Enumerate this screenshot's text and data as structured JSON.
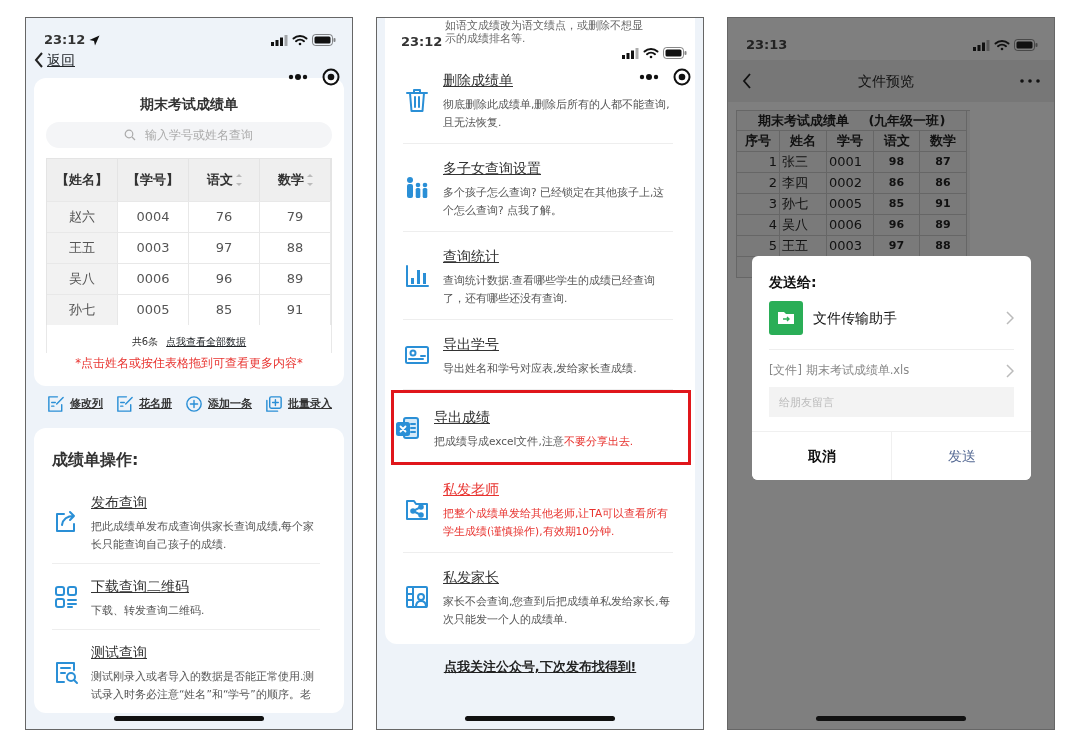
{
  "phones": [
    {
      "kind": "scores",
      "time": "23:12",
      "location": true,
      "back": "返回",
      "title": "期末考试成绩单",
      "search": {
        "placeholder": "输入学号或姓名查询"
      },
      "table": {
        "columns": [
          {
            "label": "【姓名】",
            "sortable": false
          },
          {
            "label": "【学号】",
            "sortable": false
          },
          {
            "label": "语文",
            "sortable": true
          },
          {
            "label": "数学",
            "sortable": true
          }
        ],
        "rows": [
          [
            "赵六",
            "0004",
            "76",
            "79"
          ],
          [
            "王五",
            "0003",
            "97",
            "88"
          ],
          [
            "吴八",
            "0006",
            "96",
            "89"
          ],
          [
            "孙七",
            "0005",
            "85",
            "91"
          ]
        ]
      },
      "count": "共6条",
      "view_all": "点我查看全部数据",
      "hint": "*点击姓名或按住表格拖到可查看更多内容*",
      "tools": [
        {
          "kind": "edit",
          "label": "修改列"
        },
        {
          "kind": "edit",
          "label": "花名册"
        },
        {
          "kind": "add",
          "label": "添加一条"
        },
        {
          "kind": "batch",
          "label": "批量录入"
        }
      ],
      "section_title": "成绩单操作:",
      "actions": [
        {
          "kind": "publish",
          "title": "发布查询",
          "desc": "把此成绩单发布成查询供家长查询成绩,每个家长只能查询自己孩子的成绩.",
          "warning": false,
          "highlighted": false
        },
        {
          "kind": "qrcode",
          "title": "下载查询二维码",
          "desc": "下载、转发查询二维码.",
          "warning": false,
          "highlighted": false
        },
        {
          "kind": "test",
          "title": "测试查询",
          "desc": "测试刚录入或者导入的数据是否能正常使用.测试录入时务必注意“姓名”和“学号”的顺序。老",
          "warning": false,
          "highlighted": false
        }
      ]
    },
    {
      "kind": "menu",
      "time": "23:12",
      "top_text": "如语文成绩改为语文绩点，或删除不想显示的成绩排名等.",
      "actions": [
        {
          "kind": "delete",
          "title": "删除成绩单",
          "desc": "彻底删除此成绩单,删除后所有的人都不能查询,且无法恢复.",
          "warning": false,
          "highlighted": false
        },
        {
          "kind": "children",
          "title": "多子女查询设置",
          "desc": "多个孩子怎么查询? 已经锁定在其他孩子上,这个怎么查询? 点我了解。",
          "warning": false,
          "highlighted": false
        },
        {
          "kind": "stats",
          "title": "查询统计",
          "desc": "查询统计数据.查看哪些学生的成绩已经查询了，还有哪些还没有查询.",
          "warning": false,
          "highlighted": false
        },
        {
          "kind": "export_id",
          "title": "导出学号",
          "desc": "导出姓名和学号对应表,发给家长查成绩.",
          "warning": false,
          "highlighted": false
        },
        {
          "kind": "excel",
          "title": "导出成绩",
          "desc": "把成绩导成excel文件,注意",
          "desc_warning": "不要分享出去.",
          "warning": false,
          "highlighted": true
        },
        {
          "kind": "share",
          "title": "私发老师",
          "desc": "把整个成绩单发给其他老师,让TA可以查看所有学生成绩(谨慎操作),有效期10分钟.",
          "warning": true,
          "highlighted": false
        },
        {
          "kind": "parent",
          "title": "私发家长",
          "desc": "家长不会查询,您查到后把成绩单私发给家长,每次只能发一个人的成绩单.",
          "warning": false,
          "highlighted": false
        }
      ],
      "footer": "点我关注公众号,下次发布找得到!"
    },
    {
      "kind": "preview",
      "time": "23:13",
      "title": "文件预览",
      "sheet": {
        "title": "期末考试成绩单",
        "subtitle": "(九年级一班)",
        "columns": [
          "序号",
          "姓名",
          "学号",
          "语文",
          "数学"
        ],
        "rows": [
          [
            "1",
            "张三",
            "0001",
            "98",
            "87"
          ],
          [
            "2",
            "李四",
            "0002",
            "86",
            "86"
          ],
          [
            "3",
            "孙七",
            "0005",
            "85",
            "91"
          ],
          [
            "4",
            "吴八",
            "0006",
            "96",
            "89"
          ],
          [
            "5",
            "王五",
            "0003",
            "97",
            "88"
          ]
        ]
      },
      "dialog": {
        "heading": "发送给:",
        "recipient": "文件传输助手",
        "file": "[文件] 期末考试成绩单.xls",
        "message": {
          "placeholder": "给朋友留言"
        },
        "buttons": [
          {
            "label": "取消",
            "primary": false
          },
          {
            "label": "发送",
            "primary": true
          }
        ]
      }
    }
  ]
}
